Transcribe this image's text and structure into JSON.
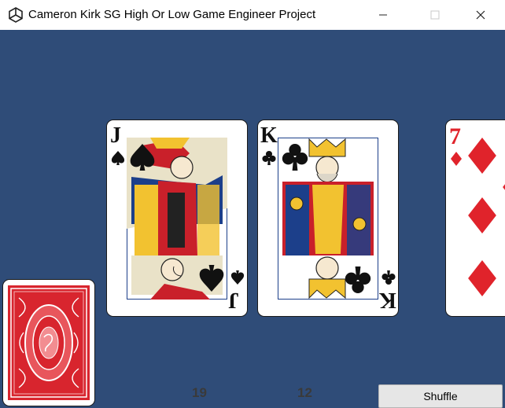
{
  "window": {
    "title": "Cameron Kirk SG High Or Low Game Engineer Project",
    "icon": "unity-logo-icon",
    "controls": [
      "minimize-icon",
      "maximize-icon",
      "close-icon"
    ]
  },
  "cards": [
    {
      "rank": "J",
      "suit": "spades",
      "face": "jack-of-spades"
    },
    {
      "rank": "K",
      "suit": "clubs",
      "face": "king-of-clubs"
    },
    {
      "rank": "7",
      "suit": "diamonds",
      "face": "seven-of-diamonds"
    }
  ],
  "deck": {
    "icon": "card-back-icon"
  },
  "counters": {
    "left": "19",
    "right": "12"
  },
  "buttons": {
    "shuffle": "Shuffle"
  },
  "colors": {
    "table": "#2f4c78",
    "red_suit": "#e0232b",
    "black_suit": "#111111"
  }
}
